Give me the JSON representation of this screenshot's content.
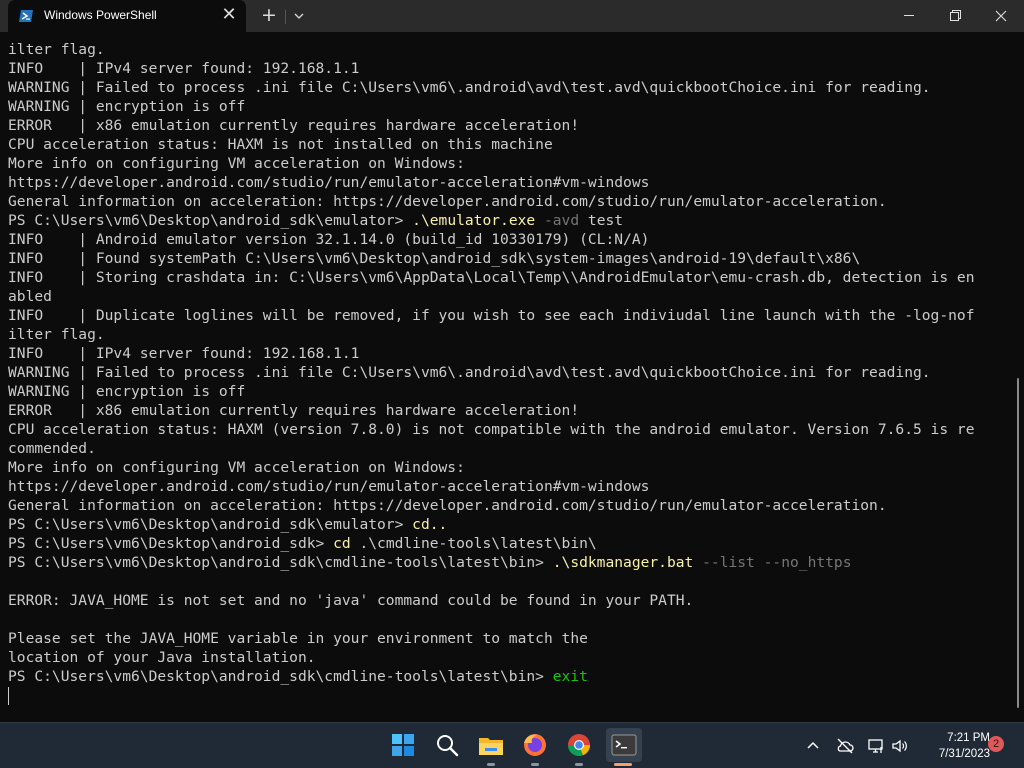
{
  "window": {
    "tab_title": "Windows PowerShell",
    "tab_close_glyph": "✕",
    "new_tab_glyph": "+"
  },
  "terminal": {
    "lines": [
      [
        {
          "t": "ilter flag."
        }
      ],
      [
        {
          "t": "INFO    | IPv4 server found: 192.168.1.1"
        }
      ],
      [
        {
          "t": "WARNING | Failed to process .ini file C:\\Users\\vm6\\.android\\avd\\test.avd\\quickbootChoice.ini for reading."
        }
      ],
      [
        {
          "t": "WARNING | encryption is off"
        }
      ],
      [
        {
          "t": "ERROR   | x86 emulation currently requires hardware acceleration!"
        }
      ],
      [
        {
          "t": "CPU acceleration status: HAXM is not installed on this machine"
        }
      ],
      [
        {
          "t": "More info on configuring VM acceleration on Windows:"
        }
      ],
      [
        {
          "t": "https://developer.android.com/studio/run/emulator-acceleration#vm-windows"
        }
      ],
      [
        {
          "t": "General information on acceleration: https://developer.android.com/studio/run/emulator-acceleration."
        }
      ],
      [
        {
          "t": "PS C:\\Users\\vm6\\Desktop\\android_sdk\\emulator> "
        },
        {
          "t": ".\\emulator.exe",
          "c": "y"
        },
        {
          "t": " -avd",
          "c": "g"
        },
        {
          "t": " test"
        }
      ],
      [
        {
          "t": "INFO    | Android emulator version 32.1.14.0 (build_id 10330179) (CL:N/A)"
        }
      ],
      [
        {
          "t": "INFO    | Found systemPath C:\\Users\\vm6\\Desktop\\android_sdk\\system-images\\android-19\\default\\x86\\"
        }
      ],
      [
        {
          "t": "INFO    | Storing crashdata in: C:\\Users\\vm6\\AppData\\Local\\Temp\\\\AndroidEmulator\\emu-crash.db, detection is en"
        }
      ],
      [
        {
          "t": "abled"
        }
      ],
      [
        {
          "t": "INFO    | Duplicate loglines will be removed, if you wish to see each indiviudal line launch with the -log-nof"
        }
      ],
      [
        {
          "t": "ilter flag."
        }
      ],
      [
        {
          "t": "INFO    | IPv4 server found: 192.168.1.1"
        }
      ],
      [
        {
          "t": "WARNING | Failed to process .ini file C:\\Users\\vm6\\.android\\avd\\test.avd\\quickbootChoice.ini for reading."
        }
      ],
      [
        {
          "t": "WARNING | encryption is off"
        }
      ],
      [
        {
          "t": "ERROR   | x86 emulation currently requires hardware acceleration!"
        }
      ],
      [
        {
          "t": "CPU acceleration status: HAXM (version 7.8.0) is not compatible with the android emulator. Version 7.6.5 is re"
        }
      ],
      [
        {
          "t": "commended."
        }
      ],
      [
        {
          "t": "More info on configuring VM acceleration on Windows:"
        }
      ],
      [
        {
          "t": "https://developer.android.com/studio/run/emulator-acceleration#vm-windows"
        }
      ],
      [
        {
          "t": "General information on acceleration: https://developer.android.com/studio/run/emulator-acceleration."
        }
      ],
      [
        {
          "t": "PS C:\\Users\\vm6\\Desktop\\android_sdk\\emulator> "
        },
        {
          "t": "cd..",
          "c": "y"
        }
      ],
      [
        {
          "t": "PS C:\\Users\\vm6\\Desktop\\android_sdk> "
        },
        {
          "t": "cd",
          "c": "y"
        },
        {
          "t": " .\\cmdline-tools\\latest\\bin\\"
        }
      ],
      [
        {
          "t": "PS C:\\Users\\vm6\\Desktop\\android_sdk\\cmdline-tools\\latest\\bin> "
        },
        {
          "t": ".\\sdkmanager.bat",
          "c": "y"
        },
        {
          "t": " --list --no_https",
          "c": "g"
        }
      ],
      [
        {
          "t": ""
        }
      ],
      [
        {
          "t": "ERROR: JAVA_HOME is not set and no 'java' command could be found in your PATH."
        }
      ],
      [
        {
          "t": ""
        }
      ],
      [
        {
          "t": "Please set the JAVA_HOME variable in your environment to match the"
        }
      ],
      [
        {
          "t": "location of your Java installation."
        }
      ],
      [
        {
          "t": "PS C:\\Users\\vm6\\Desktop\\android_sdk\\cmdline-tools\\latest\\bin> "
        },
        {
          "t": "exit",
          "c": "gr"
        }
      ]
    ]
  },
  "taskbar": {
    "apps": [
      "start-icon",
      "search-icon",
      "file-explorer-icon",
      "firefox-icon",
      "chrome-icon",
      "terminal-icon"
    ],
    "time": "7:21 PM",
    "date": "7/31/2023",
    "notification_count": "2"
  },
  "colors": {
    "terminal_bg": "#0c0c0c",
    "terminal_fg": "#cccccc",
    "command": "#f9f1a5",
    "argument": "#767676",
    "exit_command": "#16c60c",
    "titlebar_bg": "#2b2b2b",
    "taskbar_bg": "#1f2a36"
  }
}
